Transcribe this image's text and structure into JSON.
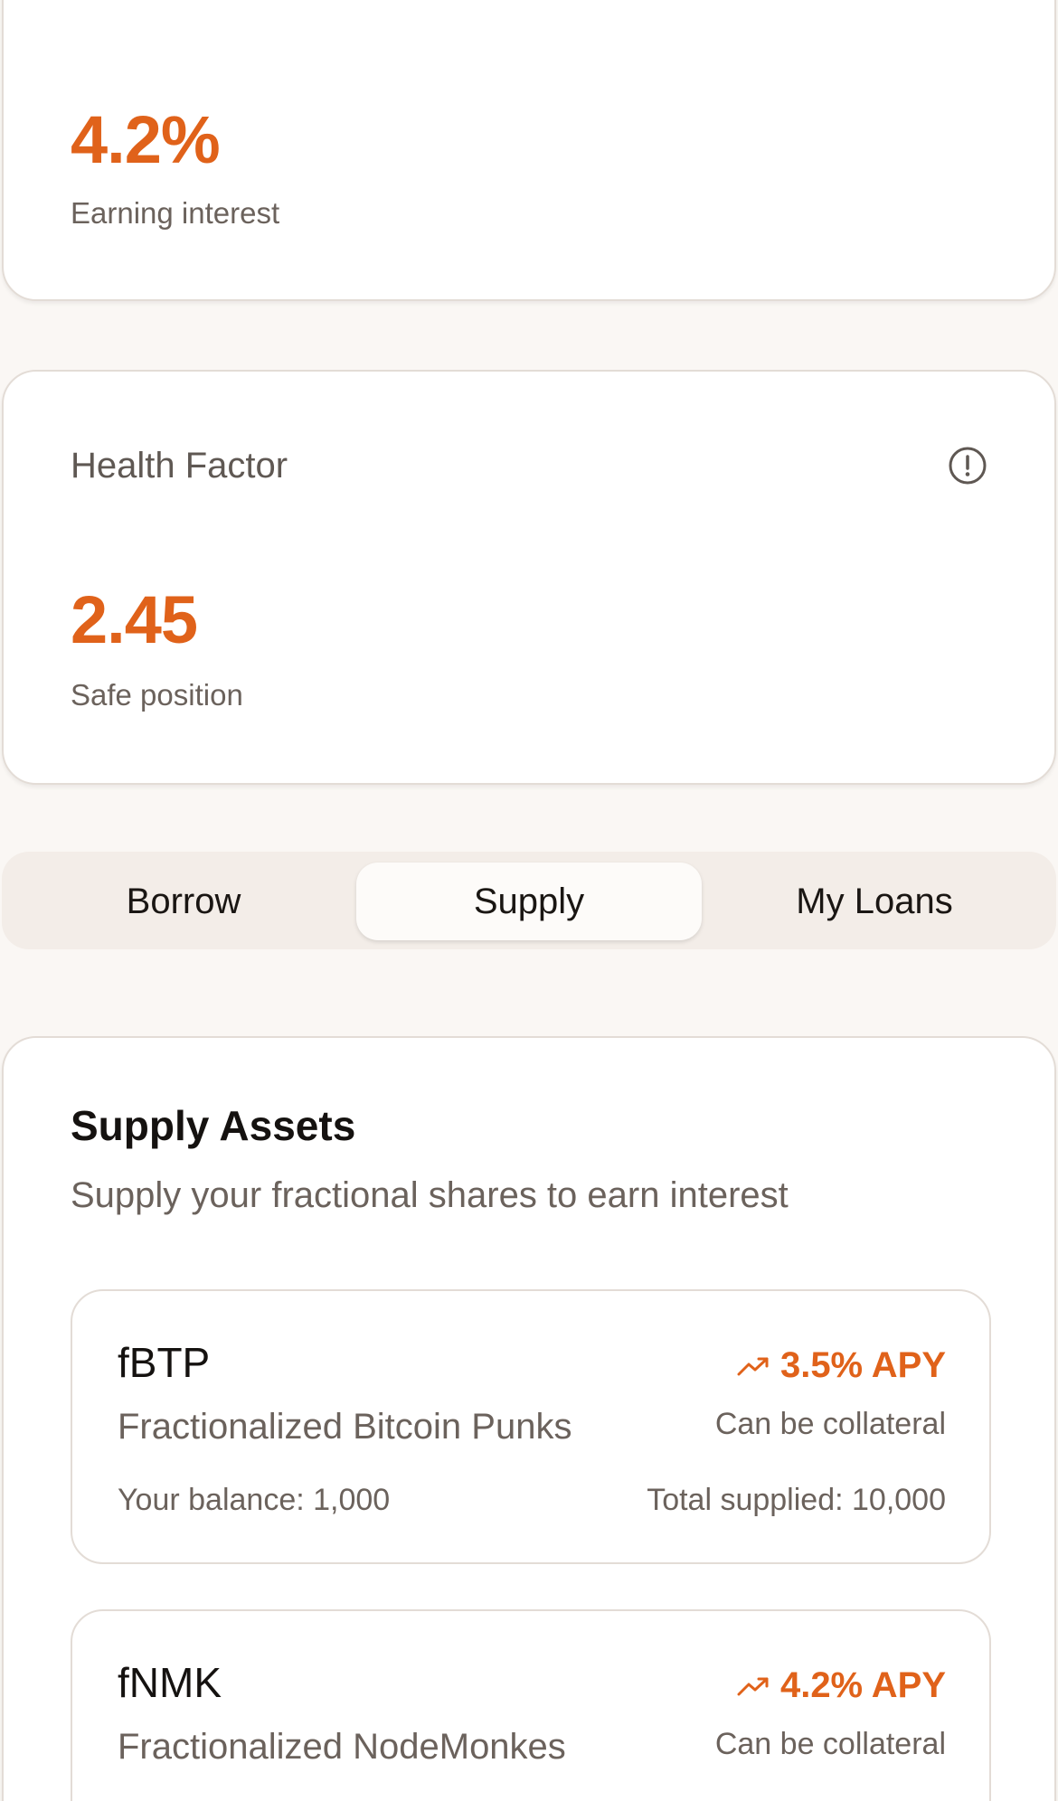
{
  "earning": {
    "value": "4.2%",
    "caption": "Earning interest"
  },
  "health": {
    "title": "Health Factor",
    "icon": "info-circle-icon",
    "value": "2.45",
    "caption": "Safe position"
  },
  "tabs": [
    {
      "label": "Borrow",
      "active": false
    },
    {
      "label": "Supply",
      "active": true
    },
    {
      "label": "My Loans",
      "active": false
    }
  ],
  "supply": {
    "title": "Supply Assets",
    "subtitle": "Supply your fractional shares to earn interest",
    "assets": [
      {
        "symbol": "fBTP",
        "name": "Fractionalized Bitcoin Punks",
        "apy": "3.5% APY",
        "collateral": "Can be collateral",
        "balance": "Your balance: 1,000",
        "total": "Total supplied: 10,000"
      },
      {
        "symbol": "fNMK",
        "name": "Fractionalized NodeMonkes",
        "apy": "4.2% APY",
        "collateral": "Can be collateral"
      }
    ]
  },
  "colors": {
    "accent": "#e0621a",
    "background": "#faf7f4",
    "card": "#ffffff",
    "tab_track": "#f3ede8",
    "muted_text": "#6b625c"
  }
}
